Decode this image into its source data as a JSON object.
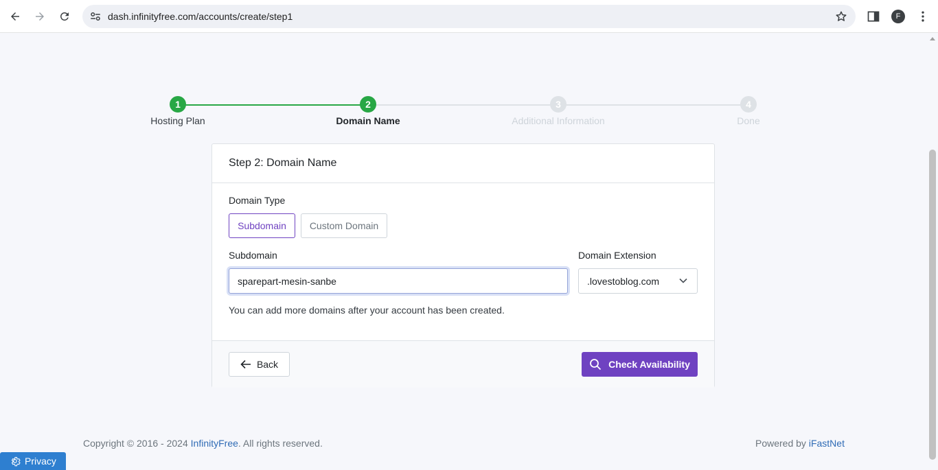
{
  "browser": {
    "url": "dash.infinityfree.com/accounts/create/step1",
    "avatar_letter": "F"
  },
  "stepper": {
    "steps": [
      {
        "number": "1",
        "label": "Hosting Plan",
        "state": "complete"
      },
      {
        "number": "2",
        "label": "Domain Name",
        "state": "active"
      },
      {
        "number": "3",
        "label": "Additional Information",
        "state": "pending"
      },
      {
        "number": "4",
        "label": "Done",
        "state": "pending"
      }
    ]
  },
  "card": {
    "title": "Step 2: Domain Name",
    "domain_type_label": "Domain Type",
    "subdomain_button": "Subdomain",
    "custom_domain_button": "Custom Domain",
    "subdomain_label": "Subdomain",
    "subdomain_value": "sparepart-mesin-sanbe",
    "extension_label": "Domain Extension",
    "extension_value": ".lovestoblog.com",
    "help_text": "You can add more domains after your account has been created.",
    "back_button": "Back",
    "check_button": "Check Availability"
  },
  "footer": {
    "copyright_prefix": "Copyright © 2016 - 2024 ",
    "brand_link": "InfinityFree",
    "copyright_suffix": ". All rights reserved.",
    "powered_prefix": "Powered by ",
    "powered_link": "iFastNet"
  },
  "privacy_label": "Privacy",
  "colors": {
    "accent": "#6f42c1",
    "success": "#28a745",
    "pending": "#dee2e6",
    "link": "#2f6bb5"
  }
}
